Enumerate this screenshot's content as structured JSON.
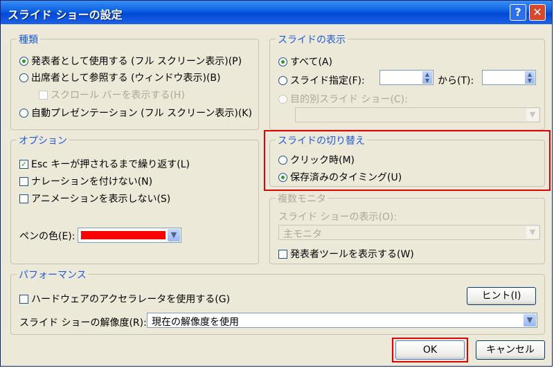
{
  "window": {
    "title": "スライド ショーの設定",
    "help_label": "?",
    "close_label": "✕"
  },
  "type_group": {
    "legend": "種類",
    "presenter_label": "発表者として使用する (フル スクリーン表示)(P)",
    "browsed_label": "出席者として参照する (ウィンドウ表示)(B)",
    "scrollbar_label": "スクロール バーを表示する(H)",
    "kiosk_label": "自動プレゼンテーション (フル スクリーン表示)(K)"
  },
  "slides_group": {
    "legend": "スライドの表示",
    "all_label": "すべて(A)",
    "range_label": "スライド指定(F):",
    "to_label": "から(T):",
    "from_value": "",
    "to_value": "",
    "custom_label": "目的別スライド ショー(C):",
    "custom_value": ""
  },
  "options_group": {
    "legend": "オプション",
    "loop_label": "Esc キーが押されるまで繰り返す(L)",
    "no_narration_label": "ナレーションを付けない(N)",
    "no_animation_label": "アニメーションを表示しない(S)",
    "pen_color_label": "ペンの色(E):",
    "pen_color": "#ff0000"
  },
  "advance_group": {
    "legend": "スライドの切り替え",
    "manual_label": "クリック時(M)",
    "timings_label": "保存済みのタイミング(U)"
  },
  "monitor_group": {
    "legend": "複数モニタ",
    "display_label": "スライド ショーの表示(O):",
    "display_value": "主モニタ",
    "presenter_tools_label": "発表者ツールを表示する(W)"
  },
  "performance_group": {
    "legend": "パフォーマンス",
    "hw_accel_label": "ハードウェアのアクセラレータを使用する(G)",
    "tips_label": "ヒント(I)",
    "resolution_label": "スライド ショーの解像度(R):",
    "resolution_value": "現在の解像度を使用"
  },
  "buttons": {
    "ok_label": "OK",
    "cancel_label": "キャンセル"
  },
  "icons": {
    "dropdown": "▼",
    "spin_up": "▲",
    "spin_down": "▼",
    "check": "✓"
  },
  "colors": {
    "highlight": "#e00000",
    "legend_text": "#1c5be0"
  }
}
